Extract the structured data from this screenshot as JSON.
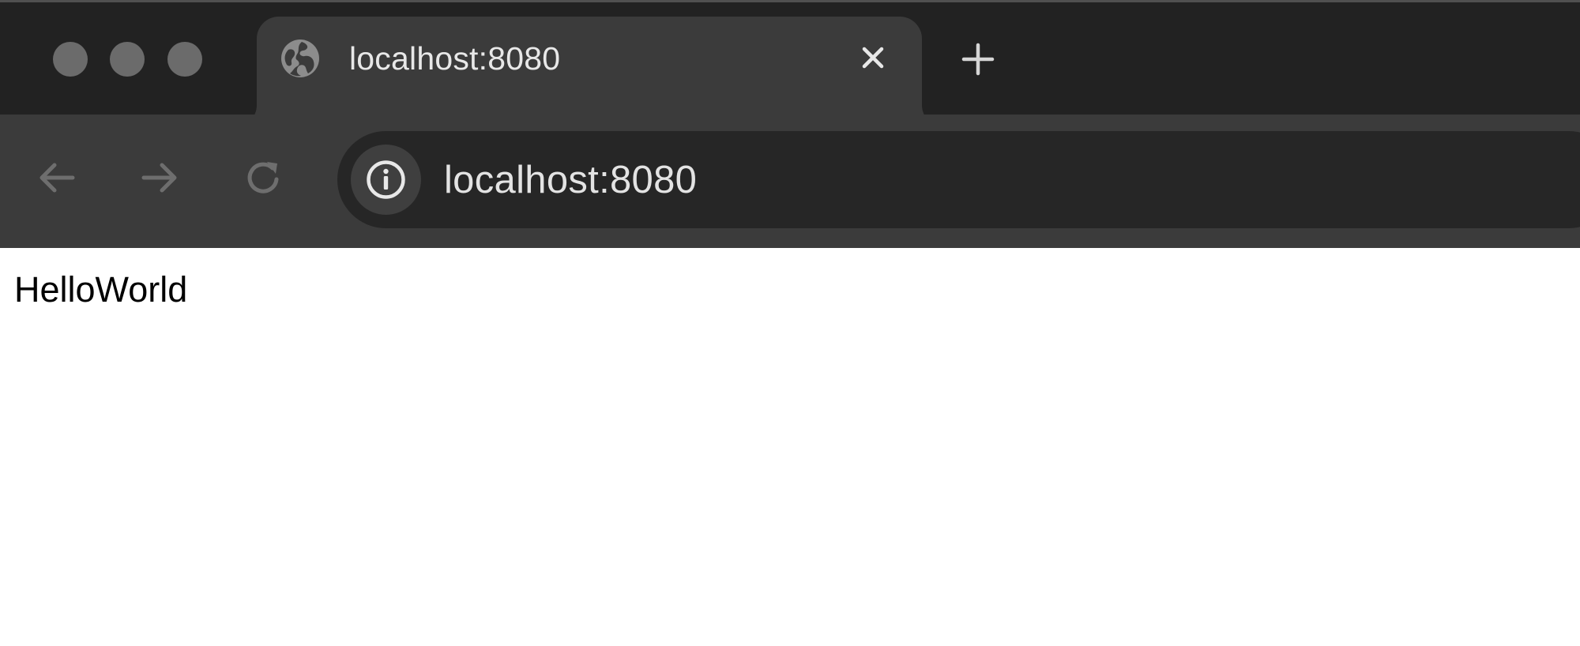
{
  "window": {
    "controls": [
      "close",
      "minimize",
      "zoom"
    ]
  },
  "tab": {
    "title": "localhost:8080",
    "favicon_icon": "globe-icon",
    "close_icon": "close-icon"
  },
  "new_tab": {
    "icon": "plus-icon"
  },
  "toolbar": {
    "back_icon": "arrow-left-icon",
    "forward_icon": "arrow-right-icon",
    "reload_icon": "reload-icon",
    "site_info_icon": "info-icon",
    "url": "localhost:8080"
  },
  "page": {
    "text": "HelloWorld"
  },
  "colors": {
    "tabstrip_bg": "#222222",
    "active_tab_bg": "#3b3b3b",
    "omnibox_bg": "#262626",
    "page_bg": "#ffffff"
  }
}
